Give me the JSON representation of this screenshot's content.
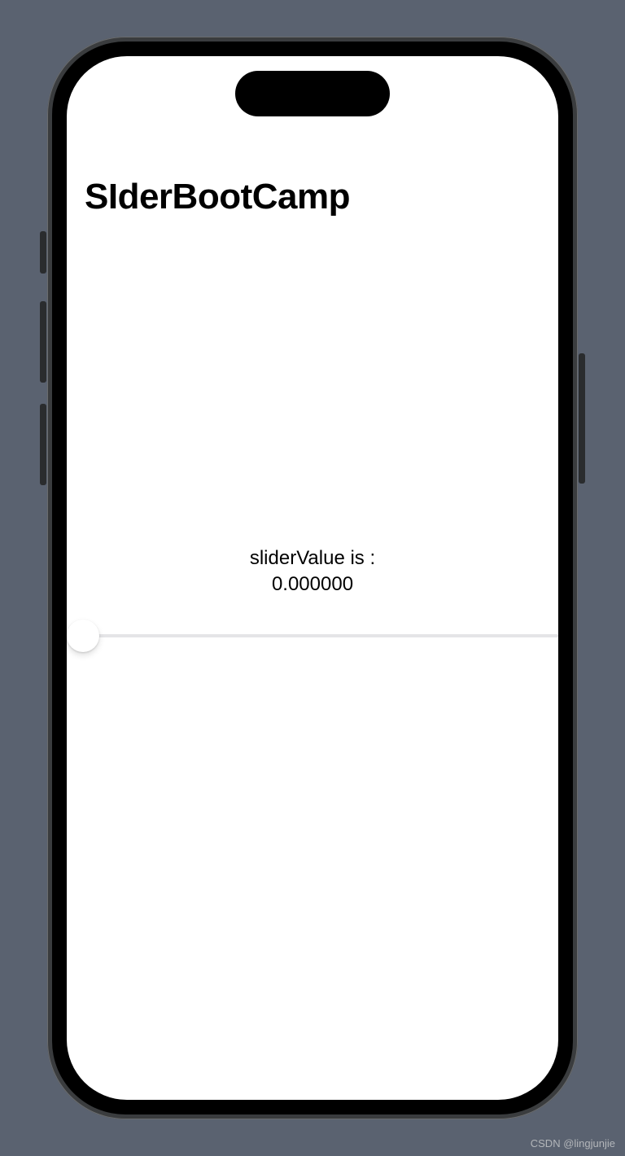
{
  "nav": {
    "title": "SIderBootCamp"
  },
  "content": {
    "slider_label": "sliderValue is :",
    "slider_value": "0.000000",
    "slider_position": 0
  },
  "watermark": "CSDN @lingjunjie"
}
